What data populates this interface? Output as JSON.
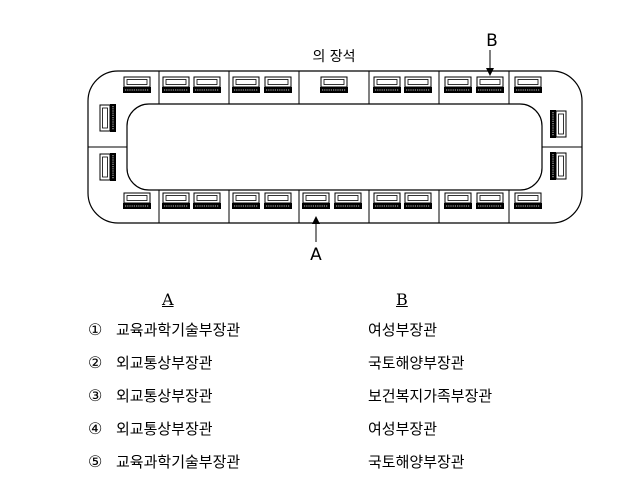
{
  "diagram": {
    "top_label": "의 장석",
    "pointer_b": "B",
    "pointer_a": "A"
  },
  "options": {
    "header_a": "A",
    "header_b": "B",
    "rows": [
      {
        "num": "①",
        "a": "교육과학기술부장관",
        "b": "여성부장관"
      },
      {
        "num": "②",
        "a": "외교통상부장관",
        "b": "국토해양부장관"
      },
      {
        "num": "③",
        "a": "외교통상부장관",
        "b": "보건복지가족부장관"
      },
      {
        "num": "④",
        "a": "외교통상부장관",
        "b": "여성부장관"
      },
      {
        "num": "⑤",
        "a": "교육과학기술부장관",
        "b": "국토해양부장관"
      }
    ]
  }
}
